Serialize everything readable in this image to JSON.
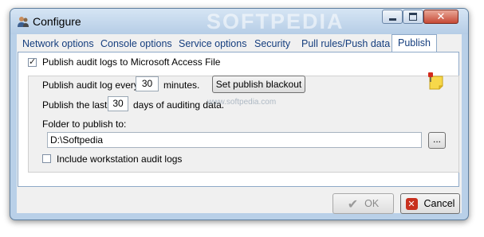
{
  "window": {
    "title": "Configure",
    "watermark": "SOFTPEDIA"
  },
  "tabs": [
    {
      "label": "Network options",
      "active": false
    },
    {
      "label": "Console options",
      "active": false
    },
    {
      "label": "Service options",
      "active": false
    },
    {
      "label": "Security",
      "active": false
    },
    {
      "label": "Pull rules/Push data",
      "active": false
    },
    {
      "label": "Publish",
      "active": true
    }
  ],
  "publish": {
    "publish_to_access_label": "Publish audit logs to Microsoft Access File",
    "publish_to_access_checked": true,
    "every_prefix": "Publish audit log every",
    "every_value": "30",
    "every_suffix": "minutes.",
    "blackout_button": "Set publish blackout",
    "last_prefix": "Publish the last",
    "last_value": "30",
    "last_suffix": "days of auditing data.",
    "folder_label": "Folder to publish to:",
    "folder_value": "D:\\Softpedia",
    "browse_button": "...",
    "include_workstation_label": "Include workstation audit logs",
    "include_workstation_checked": false,
    "site_watermark": "www.softpedia.com"
  },
  "buttons": {
    "ok": "OK",
    "cancel": "Cancel"
  },
  "icons": {
    "app": "users-icon",
    "note": "sticky-note-pin-icon",
    "ok": "checkmark-icon",
    "cancel": "red-x-icon"
  }
}
